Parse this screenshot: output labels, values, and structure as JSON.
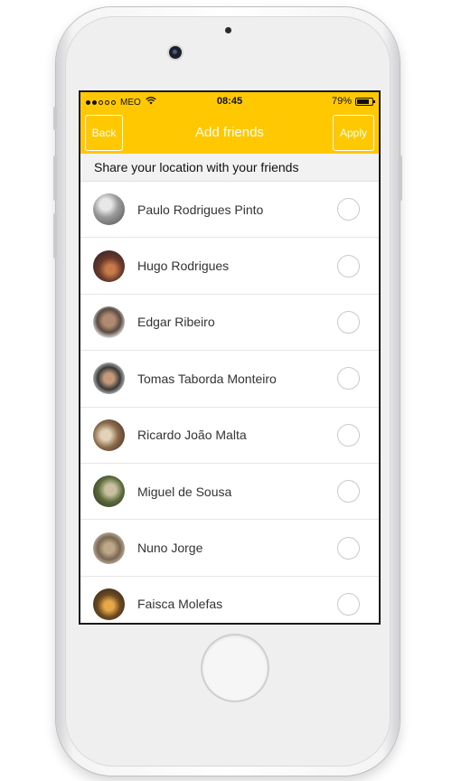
{
  "status_bar": {
    "carrier": "MEO",
    "time": "08:45",
    "battery": "79%"
  },
  "nav": {
    "back_label": "Back",
    "title": "Add friends",
    "apply_label": "Apply"
  },
  "section_header": "Share your location with your friends",
  "friends": [
    {
      "name": "Paulo Rodrigues Pinto"
    },
    {
      "name": "Hugo Rodrigues"
    },
    {
      "name": "Edgar Ribeiro"
    },
    {
      "name": "Tomas Taborda Monteiro"
    },
    {
      "name": "Ricardo João Malta"
    },
    {
      "name": "Miguel de Sousa"
    },
    {
      "name": "Nuno Jorge"
    },
    {
      "name": "Faisca Molefas"
    }
  ],
  "colors": {
    "accent": "#ffc800",
    "section_bg": "#f2f2f2"
  }
}
